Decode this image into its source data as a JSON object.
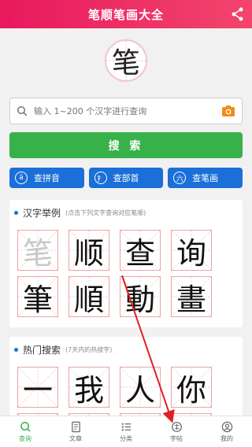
{
  "header": {
    "title": "笔顺笔画大全"
  },
  "logo": {
    "char": "笔"
  },
  "search": {
    "placeholder": "输入 1~200 个汉字进行查询",
    "button_label": "搜 索"
  },
  "modes": [
    {
      "label": "查拼音",
      "icon_glyph": "ā"
    },
    {
      "label": "查部首",
      "icon_glyph": "扌"
    },
    {
      "label": "查笔画",
      "icon_glyph": "六"
    }
  ],
  "examples": {
    "heading": "汉字举例",
    "hint": "(点击下列文字查询对应笔顺)",
    "rows": [
      [
        "笔",
        "顺",
        "查",
        "询"
      ],
      [
        "筆",
        "順",
        "動",
        "畫"
      ]
    ]
  },
  "hot": {
    "heading": "热门搜索",
    "hint": "(7天内的热搜字)",
    "rows": [
      [
        "一",
        "我",
        "人",
        "你"
      ]
    ]
  },
  "tabs": [
    {
      "label": "查询",
      "icon": "search-icon",
      "active": true
    },
    {
      "label": "文章",
      "icon": "article-icon",
      "active": false
    },
    {
      "label": "分类",
      "icon": "list-icon",
      "active": false
    },
    {
      "label": "字帖",
      "icon": "copybook-icon",
      "active": false
    },
    {
      "label": "我的",
      "icon": "user-icon",
      "active": false
    }
  ],
  "colors": {
    "header_gradient": [
      "#e8195e",
      "#f2456d"
    ],
    "search_button": "#37b14a",
    "mode_button": "#1a6fd8",
    "grid_line": "#e9a5a5",
    "annotation_arrow": "#e02020"
  }
}
